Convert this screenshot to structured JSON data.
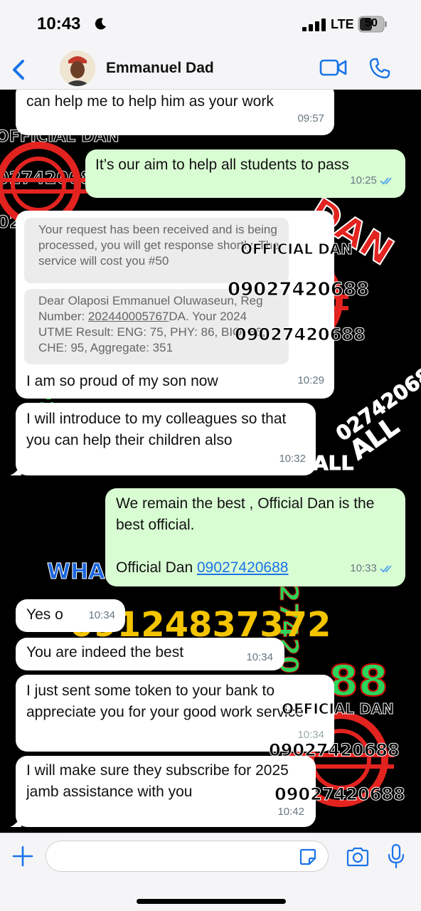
{
  "status_bar": {
    "time": "10:43",
    "network": "LTE",
    "battery": "50"
  },
  "header": {
    "contact_name": "Emmanuel Dad"
  },
  "watermarks": {
    "official_dan": "OFFICIAL DAN",
    "phone_main": "09027420688",
    "phone_partial_1": "027420688",
    "phone_partial_2": "027420688",
    "phone_alt": "09124837372",
    "phone_vertical": "09027420688",
    "phone_side_left": "09124",
    "dan": "DAN",
    "all": "ALL",
    "wha": "WHA",
    "num_88": "88"
  },
  "messages": [
    {
      "direction": "in",
      "text": "can help me to help him as your work",
      "time": "09:57"
    },
    {
      "direction": "out",
      "text": "It’s our aim to help all students to pass",
      "time": "10:25"
    },
    {
      "direction": "in",
      "quote1": "Your request has been received and is being processed, you will get response shortly. The service will cost you #50",
      "quote2_prefix": "Dear Olaposi Emmanuel Oluwaseun, Reg Number: ",
      "quote2_reg": "202440005767",
      "quote2_suffix": "DA. Your 2024 UTME Result: ENG: 75, PHY: 86, BIO: 86, CHE: 95, Aggregate: 351",
      "text": "I am so proud of my son now",
      "time": "10:29"
    },
    {
      "direction": "in",
      "text": "I will introduce to my colleagues so that you can help their children also",
      "time": "10:32"
    },
    {
      "direction": "out",
      "line1": "We remain the best , Official Dan is the best official.",
      "sign_label": "Official Dan ",
      "sign_phone": "09027420688",
      "time": "10:33"
    },
    {
      "direction": "in",
      "text": "Yes o",
      "time": "10:34"
    },
    {
      "direction": "in",
      "text": "You are indeed the best",
      "time": "10:34"
    },
    {
      "direction": "in",
      "text": "I just sent some token to your bank to appreciate you for your good work service",
      "time": "10:34"
    },
    {
      "direction": "in",
      "text": "I will make sure they subscribe for 2025 jamb assistance with you",
      "time": "10:42"
    }
  ],
  "colors": {
    "bubble_in": "#ffffff",
    "bubble_out": "#d9fdd3",
    "accent_blue": "#1a73e8",
    "stamp_red": "#e3231f"
  },
  "icons": [
    "moon-icon",
    "signal-icon",
    "battery-icon",
    "back-chevron-icon",
    "video-call-icon",
    "phone-call-icon",
    "double-check-icon",
    "plus-icon",
    "sticker-icon",
    "camera-icon",
    "mic-icon",
    "stamp-seal-icon"
  ]
}
